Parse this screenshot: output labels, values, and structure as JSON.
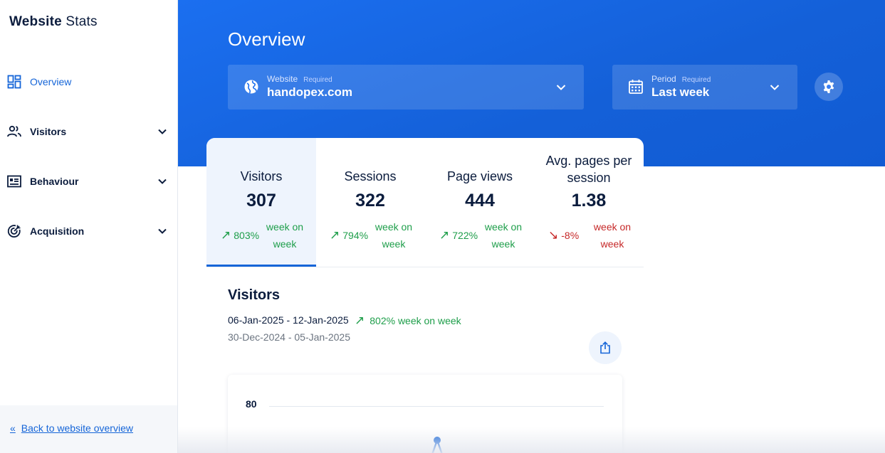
{
  "brand": {
    "bold": "Website",
    "thin": "Stats"
  },
  "sidebar": {
    "items": [
      {
        "label": "Overview",
        "icon": "dashboard-icon",
        "active": true
      },
      {
        "label": "Visitors",
        "icon": "people-icon",
        "expandable": true
      },
      {
        "label": "Behaviour",
        "icon": "list-icon",
        "expandable": true
      },
      {
        "label": "Acquisition",
        "icon": "target-icon",
        "expandable": true
      }
    ],
    "back_link": "Back to website overview"
  },
  "header": {
    "title": "Overview",
    "website": {
      "label": "Website",
      "required": "Required",
      "value": "handopex.com",
      "icon": "globe-icon"
    },
    "period": {
      "label": "Period",
      "required": "Required",
      "value": "Last week",
      "icon": "calendar-icon"
    }
  },
  "stats": [
    {
      "label": "Visitors",
      "value": "307",
      "change": "803%",
      "trend": "up",
      "suffix": "week on week",
      "active": true
    },
    {
      "label": "Sessions",
      "value": "322",
      "change": "794%",
      "trend": "up",
      "suffix": "week on week"
    },
    {
      "label": "Page views",
      "value": "444",
      "change": "722%",
      "trend": "up",
      "suffix": "week on week"
    },
    {
      "label": "Avg. pages per session",
      "value": "1.38",
      "change": "-8%",
      "trend": "down",
      "suffix": "week on week"
    }
  ],
  "visitors_section": {
    "title": "Visitors",
    "current_range": "06-Jan-2025 - 12-Jan-2025",
    "change": "802% week on week",
    "previous_range": "30-Dec-2024 - 05-Jan-2025"
  },
  "chart": {
    "y_tick": "80"
  },
  "colors": {
    "accent": "#1565d8",
    "banner": "#1b6ff0",
    "positive": "#1e9e4a",
    "negative": "#c62828"
  }
}
